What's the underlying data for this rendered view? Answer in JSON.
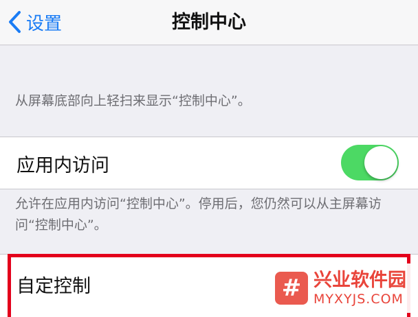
{
  "navbar": {
    "back_label": "设置",
    "title": "控制中心"
  },
  "sections": {
    "intro_footer": "从屏幕底部向上轻扫来显示“控制中心”。",
    "access_in_apps": {
      "label": "应用内访问",
      "toggle_on": true
    },
    "access_footer": "允许在应用内访问“控制中心”。停用后，您仍然可以从主屏幕访问“控制中心”。",
    "customize": {
      "label": "自定控制"
    }
  },
  "watermark": {
    "logo_glyph": "#",
    "name": "兴业软件园",
    "url": "MYXYJS.COM"
  },
  "colors": {
    "accent": "#1a7cf5",
    "toggle_on": "#4cd964",
    "highlight": "#e3001b",
    "watermark": "#e9443a"
  }
}
